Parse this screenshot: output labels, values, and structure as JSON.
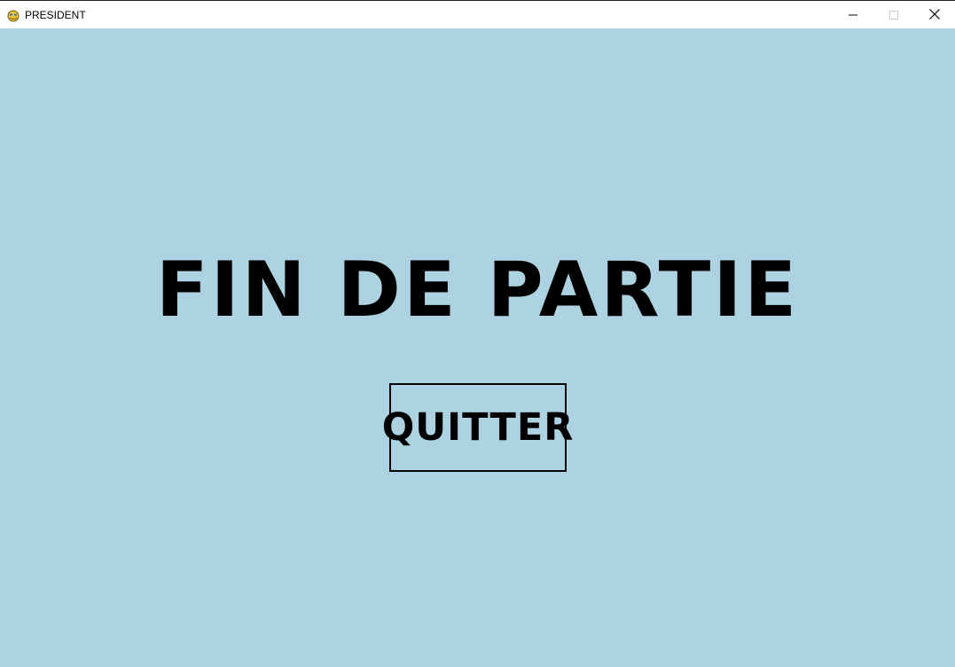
{
  "window": {
    "title": "PRESIDENT",
    "app_icon": "pygame-snake-icon",
    "controls": [
      "minimize-icon",
      "maximize-icon",
      "close-icon"
    ]
  },
  "game": {
    "background_color": "#add3e3",
    "end_title": "FIN DE PARTIE",
    "quit_button_label": "QUITTER"
  }
}
